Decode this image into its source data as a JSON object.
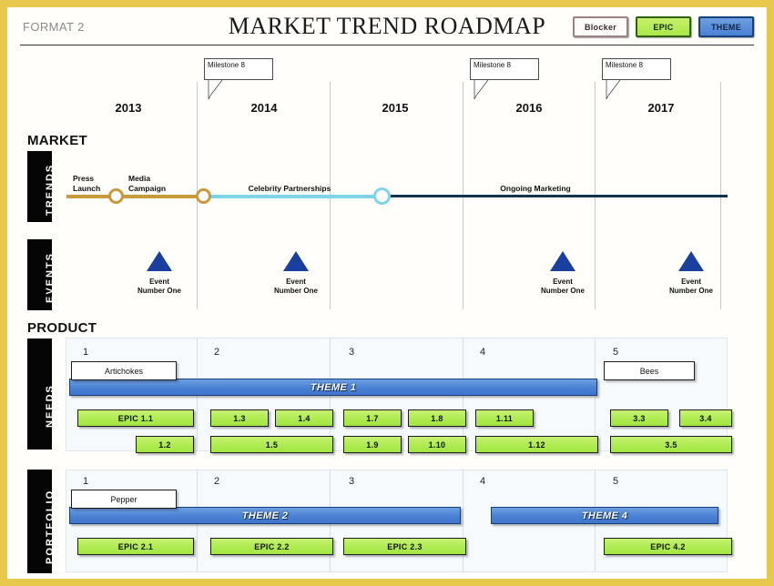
{
  "header": {
    "format_label": "FORMAT 2",
    "title": "MARKET TREND ROADMAP",
    "legend": [
      {
        "label": "Blocker",
        "kind": "blocker"
      },
      {
        "label": "EPIC",
        "kind": "epic"
      },
      {
        "label": "THEME",
        "kind": "theme"
      }
    ]
  },
  "timeline": {
    "years": [
      "2013",
      "2014",
      "2015",
      "2016",
      "2017"
    ],
    "milestones": [
      {
        "label": "Milestone 8",
        "on_year": "2014"
      },
      {
        "label": "Milestone 8",
        "on_year": "2016"
      },
      {
        "label": "Milestone 8",
        "on_year": "2017"
      }
    ]
  },
  "sections": {
    "market": "MARKET",
    "product": "PRODUCT"
  },
  "lanes": {
    "trends": "TRENDS",
    "events": "EVENTS",
    "needs": "NEEDS",
    "portfolio": "PORTFOLIO"
  },
  "trends": {
    "segments": [
      {
        "label": "",
        "color": "#c89a3c"
      },
      {
        "label": "Celebrity  Partnerships",
        "color": "#7fd4e8"
      },
      {
        "label": "Ongoing  Marketing",
        "color": "#11324f"
      }
    ],
    "labels": [
      {
        "text": "Press\nLaunch",
        "line1": "Press",
        "line2": "Launch"
      },
      {
        "text": "Media\nCampaign",
        "line1": "Media",
        "line2": "Campaign"
      },
      {
        "text": "Celebrity  Partnerships"
      },
      {
        "text": "Ongoing  Marketing"
      }
    ],
    "markers": [
      {
        "color": "#c89a3c"
      },
      {
        "color": "#c89a3c"
      },
      {
        "color": "#7fd4e8"
      }
    ]
  },
  "events": [
    {
      "line1": "Event",
      "line2": "Number One"
    },
    {
      "line1": "Event",
      "line2": "Number One"
    },
    {
      "line1": "Event",
      "line2": "Number One"
    },
    {
      "line1": "Event",
      "line2": "Number One"
    }
  ],
  "needs": {
    "cell_numbers": [
      "1",
      "2",
      "3",
      "4",
      "5"
    ],
    "callouts": [
      {
        "label": "Artichokes"
      },
      {
        "label": "Bees"
      }
    ],
    "themes": [
      {
        "label": "THEME 1"
      }
    ],
    "epics_row1": [
      "EPIC  1.1",
      "1.3",
      "1.4",
      "1.7",
      "1.8",
      "1.11",
      "3.3",
      "3.4"
    ],
    "epics_row2": [
      "1.2",
      "1.5",
      "1.9",
      "1.10",
      "1.12",
      "3.5"
    ]
  },
  "portfolio": {
    "cell_numbers": [
      "1",
      "2",
      "3",
      "4",
      "5"
    ],
    "callouts": [
      {
        "label": "Pepper"
      }
    ],
    "themes": [
      {
        "label": "THEME 2"
      },
      {
        "label": "THEME 4"
      }
    ],
    "epics": [
      "EPIC  2.1",
      "EPIC  2.2",
      "EPIC  2.3",
      "EPIC  4.2"
    ]
  },
  "colors": {
    "border_gold": "#e8c84a",
    "theme_blue": "#4a81d4",
    "epic_green": "#aceb4e",
    "event_blue": "#1b3f9e",
    "trend_gold": "#c89a3c",
    "trend_cyan": "#7fd4e8",
    "trend_navy": "#11324f"
  }
}
